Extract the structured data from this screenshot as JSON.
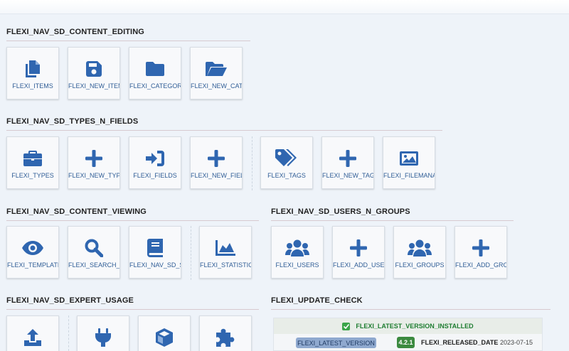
{
  "sections": {
    "content_editing": "FLEXI_NAV_SD_CONTENT_EDITING",
    "types_n_fields": "FLEXI_NAV_SD_TYPES_N_FIELDS",
    "content_viewing": "FLEXI_NAV_SD_CONTENT_VIEWING",
    "users_n_groups": "FLEXI_NAV_SD_USERS_N_GROUPS",
    "expert_usage": "FLEXI_NAV_SD_EXPERT_USAGE",
    "update_check": "FLEXI_UPDATE_CHECK"
  },
  "tiles": {
    "items": {
      "label": "FLEXI_ITEMS",
      "icon": "copy-icon"
    },
    "new_item": {
      "label": "FLEXI_NEW_ITEM",
      "icon": "save-icon"
    },
    "categories": {
      "label": "FLEXI_CATEGORIES",
      "icon": "folder-icon"
    },
    "new_category": {
      "label": "FLEXI_NEW_CATEGORY",
      "icon": "folder-open-icon"
    },
    "types": {
      "label": "FLEXI_TYPES",
      "icon": "briefcase-icon"
    },
    "new_type": {
      "label": "FLEXI_NEW_TYPE",
      "icon": "plus-icon"
    },
    "fields": {
      "label": "FLEXI_FIELDS",
      "icon": "sign-in-icon"
    },
    "new_field": {
      "label": "FLEXI_NEW_FIELD",
      "icon": "plus-icon"
    },
    "tags": {
      "label": "FLEXI_TAGS",
      "icon": "tags-icon"
    },
    "new_tag": {
      "label": "FLEXI_NEW_TAG",
      "icon": "plus-icon"
    },
    "filemanager": {
      "label": "FLEXI_FILEMANAGER",
      "icon": "image-icon"
    },
    "templates": {
      "label": "FLEXI_TEMPLATES",
      "icon": "eye-icon"
    },
    "search_index": {
      "label": "FLEXI_SEARCH_IND",
      "icon": "search-icon"
    },
    "nav_sd_search": {
      "label": "FLEXI_NAV_SD_SEARCH",
      "icon": "book-icon"
    },
    "statistics": {
      "label": "FLEXI_STATISTICS",
      "icon": "area-chart-icon"
    },
    "users": {
      "label": "FLEXI_USERS",
      "icon": "users-icon"
    },
    "add_user": {
      "label": "FLEXI_ADD_USER",
      "icon": "plus-icon"
    },
    "groups": {
      "label": "FLEXI_GROUPS",
      "icon": "users-icon"
    },
    "add_group": {
      "label": "FLEXI_ADD_GROUP",
      "icon": "plus-icon"
    },
    "expert_1": {
      "icon": "upload-icon"
    },
    "expert_2": {
      "icon": "plug-icon"
    },
    "expert_3": {
      "icon": "cube-icon"
    },
    "expert_4": {
      "icon": "puzzle-icon"
    }
  },
  "update": {
    "status": "FLEXI_LATEST_VERSION_INSTALLED",
    "latest_button": "FLEXI_LATEST_VERSION",
    "version": "4.2.1",
    "released_label": "FLEXI_RELEASED_DATE",
    "released_date": "2023-07-15"
  },
  "colors": {
    "icon": "#2f66b0",
    "label": "#2f5d96",
    "success": "#3aa54a"
  }
}
